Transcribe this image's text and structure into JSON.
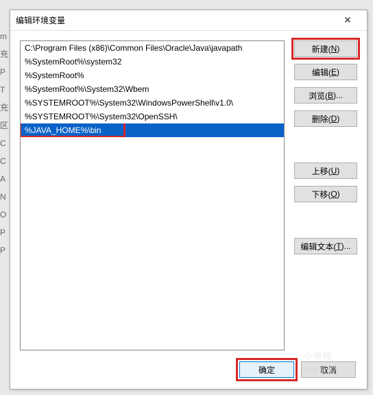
{
  "bg_fragments": [
    "m",
    "充",
    "P",
    "T",
    "充",
    "区",
    "C",
    "C",
    "A",
    "N",
    "O",
    "P",
    "P"
  ],
  "dialog": {
    "title": "编辑环境变量",
    "close_glyph": "✕"
  },
  "path_entries": [
    "C:\\Program Files (x86)\\Common Files\\Oracle\\Java\\javapath",
    "%SystemRoot%\\system32",
    "%SystemRoot%",
    "%SystemRoot%\\System32\\Wbem",
    "%SYSTEMROOT%\\System32\\WindowsPowerShell\\v1.0\\",
    "%SYSTEMROOT%\\System32\\OpenSSH\\",
    "%JAVA_HOME%\\bin"
  ],
  "selected_index": 6,
  "highlight_row_index": 6,
  "buttons": {
    "new": {
      "pre": "新建(",
      "u": "N",
      "post": ")"
    },
    "edit": {
      "pre": "编辑(",
      "u": "E",
      "post": ")"
    },
    "browse": {
      "pre": "浏览(",
      "u": "B",
      "post": ")..."
    },
    "delete": {
      "pre": "删除(",
      "u": "D",
      "post": ")"
    },
    "moveup": {
      "pre": "上移(",
      "u": "U",
      "post": ")"
    },
    "movedown": {
      "pre": "下移(",
      "u": "O",
      "post": ")"
    },
    "edittext": {
      "pre": "编辑文本(",
      "u": "T",
      "post": ")..."
    }
  },
  "footer": {
    "ok": "确定",
    "cancel": "取消"
  },
  "watermark": {
    "big": "小闻网",
    "small": "XWSNV.C"
  }
}
